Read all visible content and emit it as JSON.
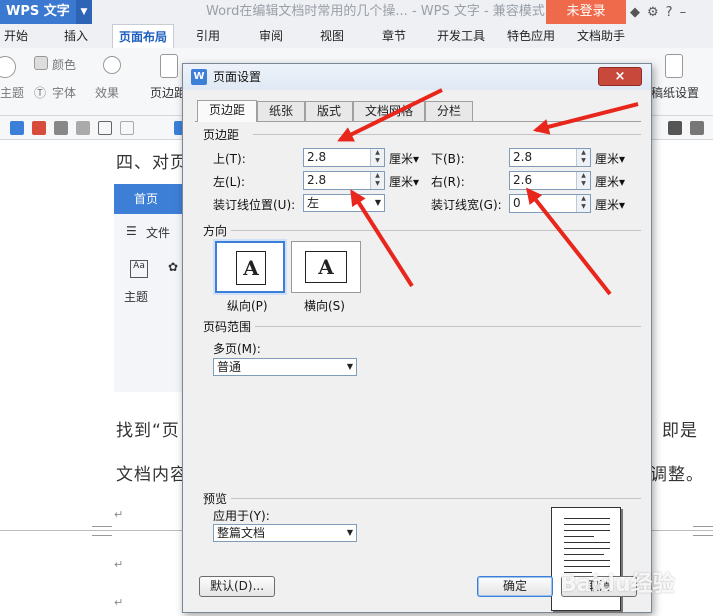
{
  "titlebar": {
    "app_name": "WPS 文字",
    "doc_title": "Word在编辑文档时常用的几个操... - WPS 文字 - 兼容模式",
    "login": "未登录"
  },
  "menu": {
    "tabs": [
      "开始",
      "插入",
      "页面布局",
      "引用",
      "审阅",
      "视图",
      "章节",
      "开发工具",
      "特色应用",
      "文档助手"
    ]
  },
  "ribbon": {
    "color_label": "颜色",
    "theme_label": "主题",
    "font_label": "字体",
    "effect_label": "效果",
    "margin_label": "页边距",
    "paper_label": "稿纸设置"
  },
  "document": {
    "heading": "四、对页",
    "embed": {
      "home": "首页",
      "file": "文件",
      "theme": "主题"
    },
    "para1": "找到“页",
    "para1_end": "即是",
    "para2": "文档内容",
    "para2_end": "调整。"
  },
  "dialog": {
    "title": "页面设置",
    "close": "×",
    "tabs": [
      "页边距",
      "纸张",
      "版式",
      "文档网格",
      "分栏"
    ],
    "margins_section": "页边距",
    "top_label": "上(T):",
    "top_value": "2.8",
    "bottom_label": "下(B):",
    "bottom_value": "2.8",
    "left_label": "左(L):",
    "left_value": "2.8",
    "right_label": "右(R):",
    "right_value": "2.6",
    "unit": "厘米",
    "gutter_pos_label": "装订线位置(U):",
    "gutter_pos_value": "左",
    "gutter_width_label": "装订线宽(G):",
    "gutter_width_value": "0",
    "orientation_section": "方向",
    "portrait": "纵向(P)",
    "landscape": "横向(S)",
    "page_range_section": "页码范围",
    "multi_label": "多页(M):",
    "multi_value": "普通",
    "preview_section": "预览",
    "apply_label": "应用于(Y):",
    "apply_value": "整篇文档",
    "default_btn": "默认(D)...",
    "ok_btn": "确定",
    "cancel_btn": "取消"
  },
  "watermark": "Baidu经验",
  "colors": {
    "accent": "#3b7fd9",
    "arrow": "#e8261c",
    "login": "#ef6a4a"
  }
}
